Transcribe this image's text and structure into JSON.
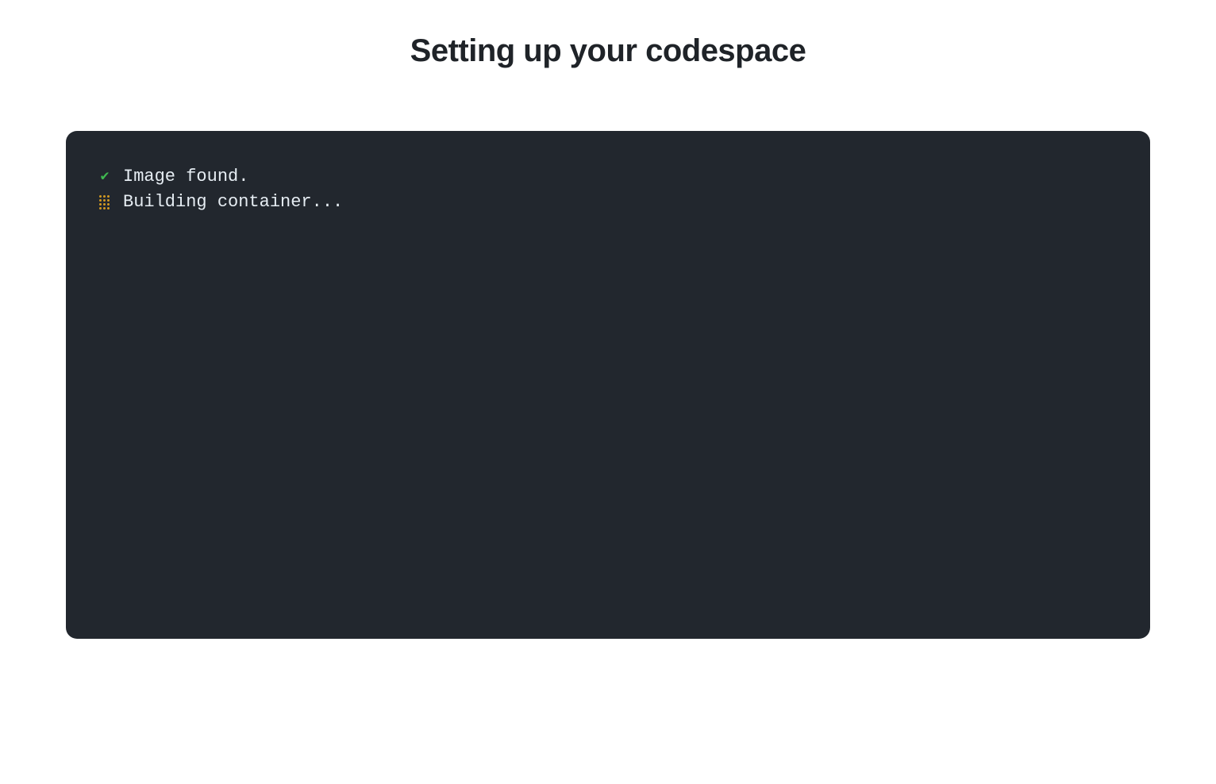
{
  "title": "Setting up your codespace",
  "terminal": {
    "lines": [
      {
        "status": "done",
        "text": "Image found."
      },
      {
        "status": "loading",
        "text": "Building container..."
      }
    ]
  },
  "colors": {
    "terminal_bg": "#22272e",
    "success": "#3fb950",
    "spinner": "#d29922",
    "text": "#e6edf3"
  }
}
